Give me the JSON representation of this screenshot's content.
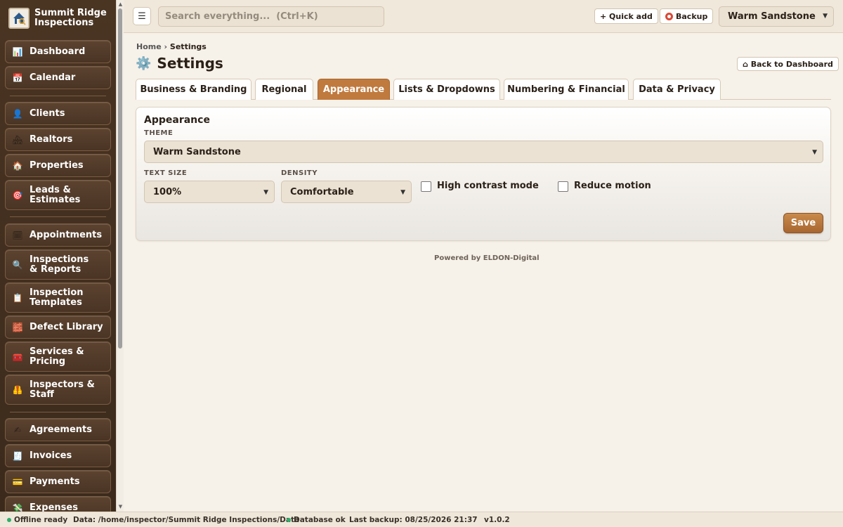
{
  "brand": {
    "name": "Summit Ridge Inspections",
    "logo_icon": "house-magnifier-icon"
  },
  "sidebar": {
    "items": [
      {
        "label": "Dashboard",
        "icon": "bar-chart-icon",
        "glyph": "📊"
      },
      {
        "label": "Calendar",
        "icon": "calendar-icon",
        "glyph": "📅"
      },
      {
        "label": "Clients",
        "icon": "person-icon",
        "glyph": "👤"
      },
      {
        "label": "Realtors",
        "icon": "houses-icon",
        "glyph": "🏘"
      },
      {
        "label": "Properties",
        "icon": "house-icon",
        "glyph": "🏠"
      },
      {
        "label": "Leads & Estimates",
        "icon": "target-icon",
        "glyph": "🎯"
      },
      {
        "label": "Appointments",
        "icon": "calendar-grid-icon",
        "glyph": "🗓"
      },
      {
        "label": "Inspections & Reports",
        "icon": "magnifier-icon",
        "glyph": "🔍"
      },
      {
        "label": "Inspection Templates",
        "icon": "clipboard-icon",
        "glyph": "📋"
      },
      {
        "label": "Defect Library",
        "icon": "brick-icon",
        "glyph": "🧱"
      },
      {
        "label": "Services & Pricing",
        "icon": "toolbox-icon",
        "glyph": "🧰"
      },
      {
        "label": "Inspectors & Staff",
        "icon": "safety-vest-icon",
        "glyph": "🦺"
      },
      {
        "label": "Agreements",
        "icon": "signing-hand-icon",
        "glyph": "✍"
      },
      {
        "label": "Invoices",
        "icon": "receipt-icon",
        "glyph": "🧾"
      },
      {
        "label": "Payments",
        "icon": "credit-card-icon",
        "glyph": "💳"
      },
      {
        "label": "Expenses",
        "icon": "money-wings-icon",
        "glyph": "💸"
      }
    ]
  },
  "topbar": {
    "menu_glyph": "☰",
    "search_placeholder": "Search everything...  (Ctrl+K)",
    "quick_add_label": "+ Quick add",
    "backup_label": "Backup",
    "theme_value": "Warm Sandstone"
  },
  "breadcrumb": {
    "home": "Home",
    "sep": "›",
    "current": "Settings"
  },
  "page": {
    "title": "Settings",
    "title_icon": "gear-icon",
    "back_label": "⌂ Back to Dashboard"
  },
  "tabs": [
    {
      "label": "Business & Branding",
      "active": false
    },
    {
      "label": "Regional",
      "active": false
    },
    {
      "label": "Appearance",
      "active": true
    },
    {
      "label": "Lists & Dropdowns",
      "active": false
    },
    {
      "label": "Numbering & Financial",
      "active": false
    },
    {
      "label": "Data & Privacy",
      "active": false
    }
  ],
  "appearance": {
    "heading": "Appearance",
    "theme_label": "THEME",
    "theme_value": "Warm Sandstone",
    "text_size_label": "TEXT SIZE",
    "text_size_value": "100%",
    "density_label": "DENSITY",
    "density_value": "Comfortable",
    "high_contrast_label": "High contrast mode",
    "high_contrast_checked": false,
    "reduce_motion_label": "Reduce motion",
    "reduce_motion_checked": false,
    "save_label": "Save"
  },
  "footer": {
    "powered_by": "Powered by ELDON-Digital"
  },
  "statusbar": {
    "offline": "Offline ready",
    "data_path": "Data: /home/inspector/Summit Ridge Inspections/Data",
    "database": "Database ok",
    "last_backup": "Last backup: 08/25/2026 21:37",
    "version": "v1.0.2"
  },
  "colors": {
    "accent": "#c07a3e",
    "sidebar": "#4a3422",
    "background": "#f6f1e9",
    "status_ok": "#2eae6b"
  }
}
